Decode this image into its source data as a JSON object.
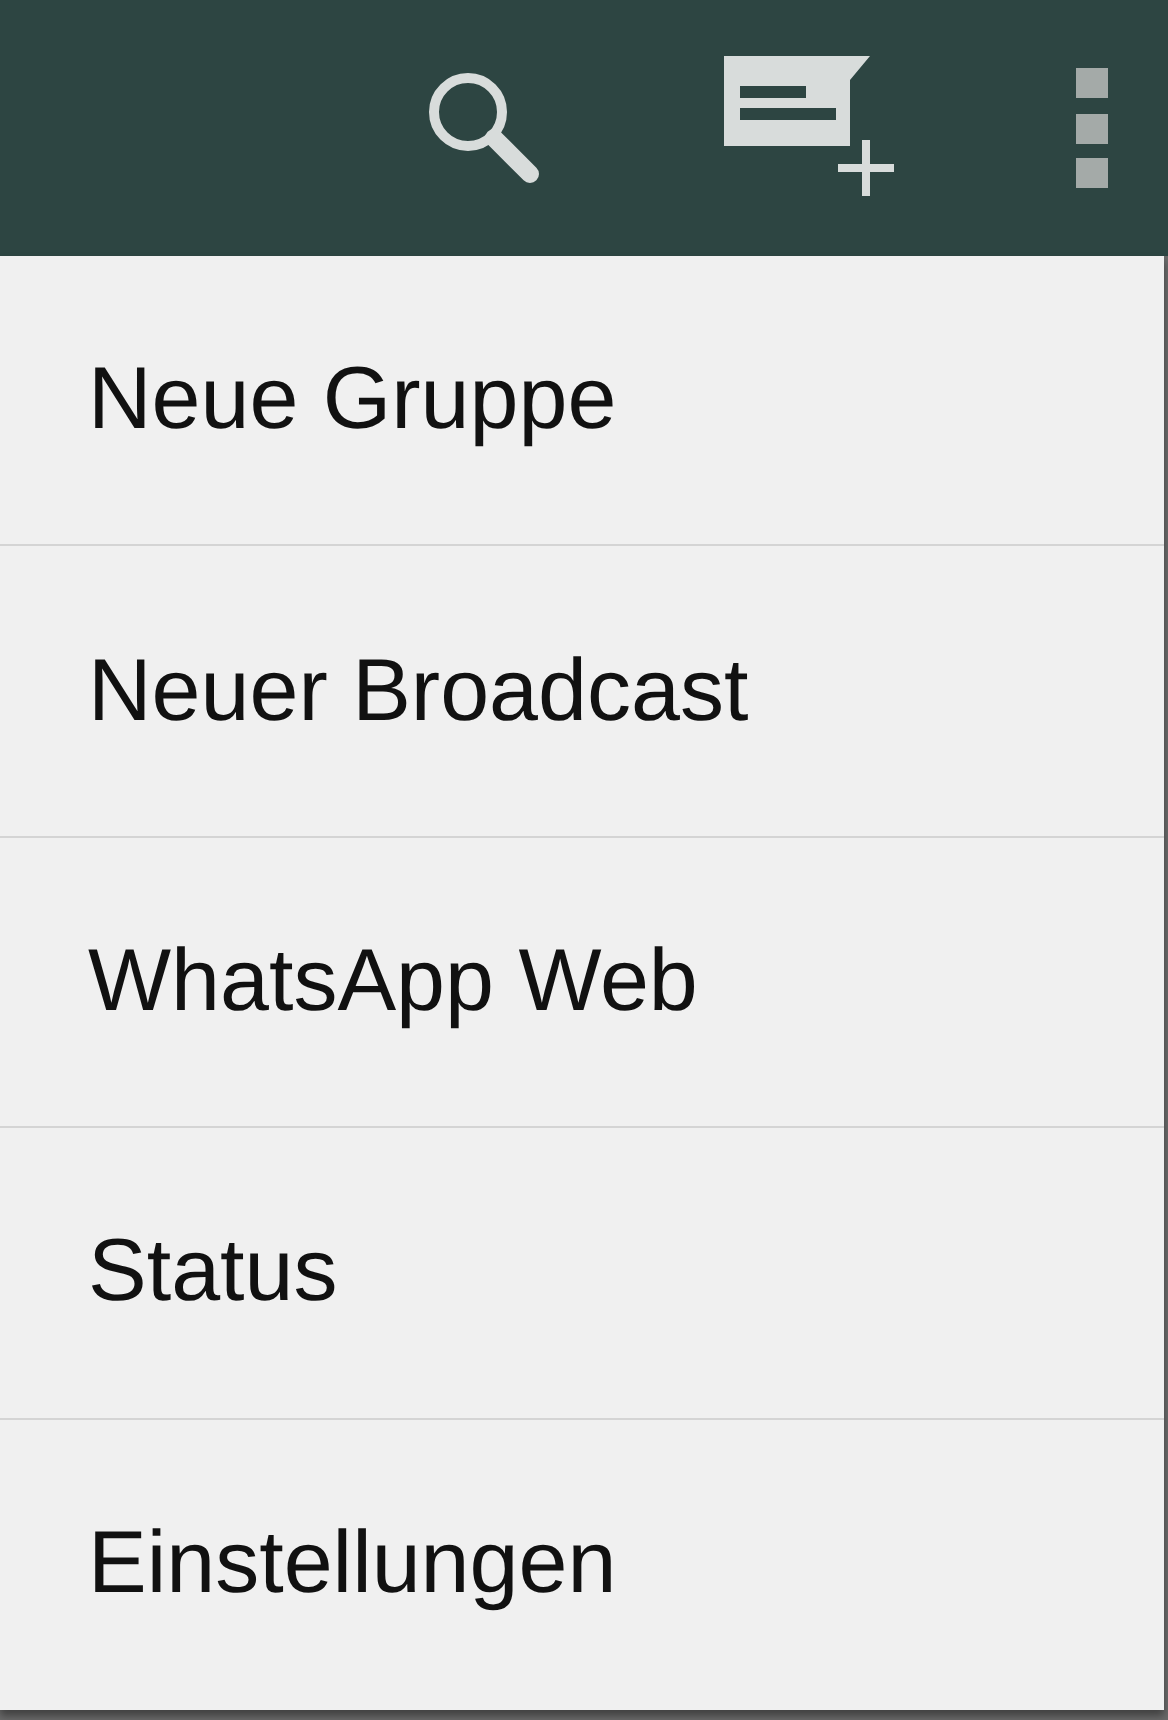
{
  "menu": {
    "items": [
      {
        "label": "Neue Gruppe"
      },
      {
        "label": "Neuer Broadcast"
      },
      {
        "label": "WhatsApp Web"
      },
      {
        "label": "Status"
      },
      {
        "label": "Einstellungen"
      }
    ]
  }
}
